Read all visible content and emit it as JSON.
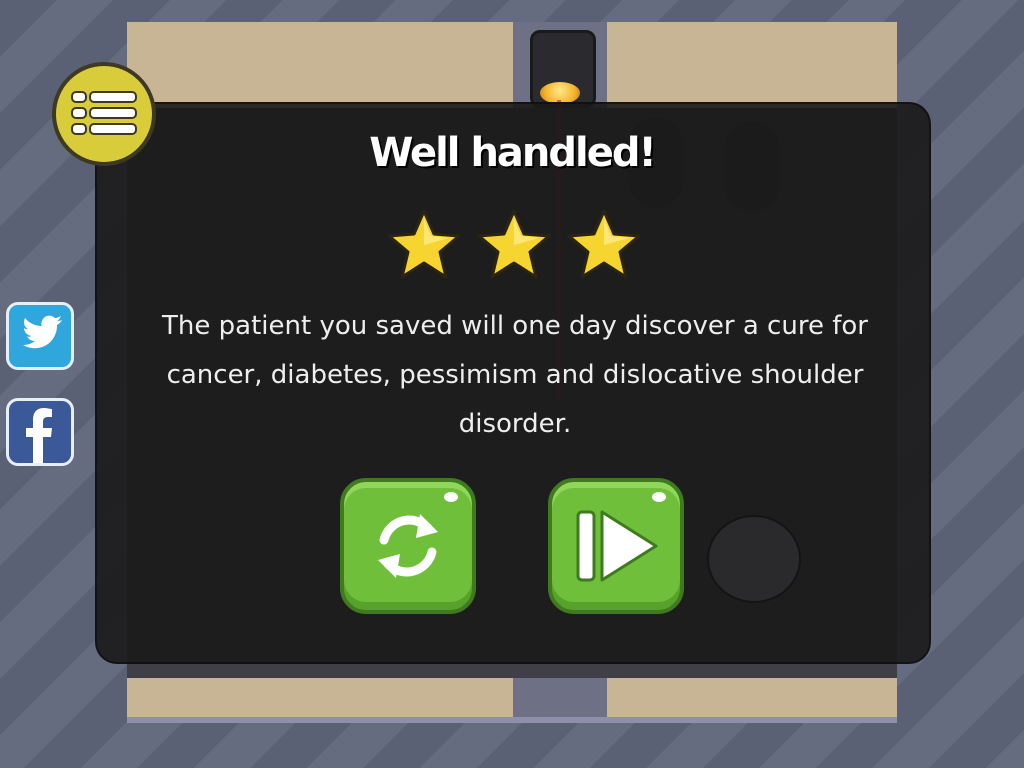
{
  "dialog": {
    "title": "Well handled!",
    "stars_earned": 3,
    "stars_total": 3,
    "message": "The patient you saved will one day discover a cure for cancer, diabetes, pessimism and dislocative shoulder disorder."
  },
  "buttons": {
    "replay": {
      "icon": "replay-icon"
    },
    "next": {
      "icon": "next-level-icon"
    },
    "menu": {
      "icon": "menu-list-icon"
    }
  },
  "social": {
    "twitter": {
      "icon": "twitter-bird-icon"
    },
    "facebook": {
      "icon": "facebook-f-icon"
    }
  },
  "colors": {
    "overlay": "#1a1a1a",
    "button_green": "#6fbf3b",
    "star_yellow": "#f7d531",
    "menu_yellow": "#d9cc3a",
    "twitter_blue": "#2fa7dd",
    "facebook_blue": "#3b5998"
  }
}
